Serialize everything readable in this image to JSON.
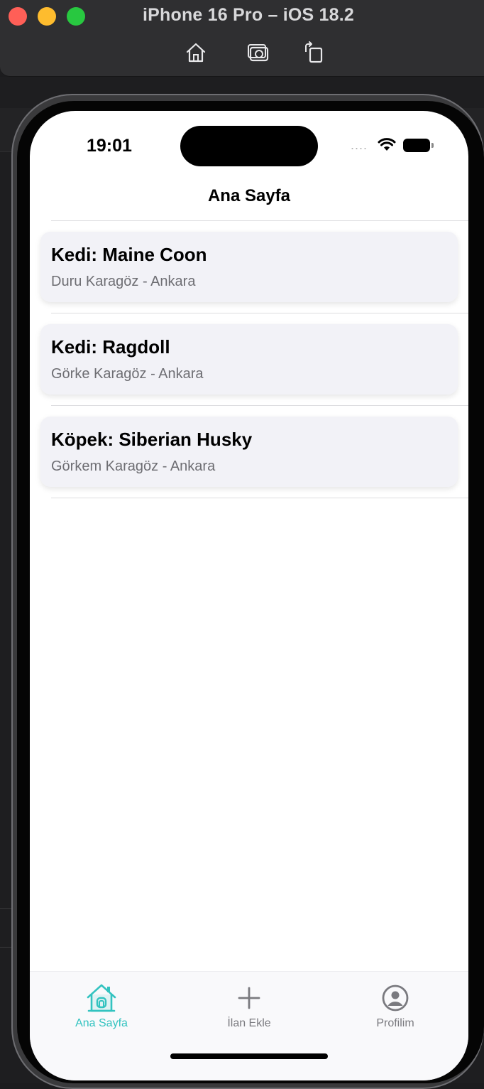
{
  "simulator": {
    "title": "iPhone 16 Pro – iOS 18.2",
    "toolbar": [
      {
        "icon": "home-icon",
        "label": ""
      },
      {
        "icon": "screenshot-icon",
        "label": ""
      },
      {
        "icon": "rotate-icon",
        "label": ""
      }
    ]
  },
  "status_bar": {
    "time": "19:01",
    "signal": "....",
    "icons": [
      "wifi-icon",
      "battery-icon"
    ]
  },
  "nav": {
    "title": "Ana Sayfa"
  },
  "listings": [
    {
      "title": "Kedi: Maine Coon",
      "subtitle": "Duru Karagöz - Ankara"
    },
    {
      "title": "Kedi: Ragdoll",
      "subtitle": "Görke Karagöz - Ankara"
    },
    {
      "title": "Köpek: Siberian Husky",
      "subtitle": "Görkem Karagöz - Ankara"
    }
  ],
  "tabbar": {
    "items": [
      {
        "label": "Ana Sayfa",
        "icon": "house-icon",
        "active": true
      },
      {
        "label": "İlan Ekle",
        "icon": "plus-icon",
        "active": false
      },
      {
        "label": "Profilim",
        "icon": "person-circle-icon",
        "active": false
      }
    ]
  },
  "colors": {
    "accent": "#33c3c0",
    "card_background": "#f2f2f7",
    "subtitle": "#6e6e73"
  }
}
